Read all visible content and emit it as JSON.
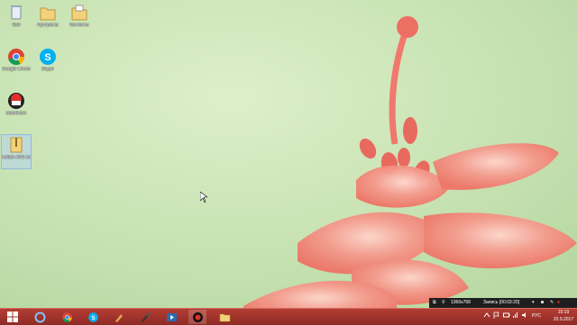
{
  "desktop": {
    "icons": [
      {
        "label": "Кой"
      },
      {
        "label": "Программ"
      },
      {
        "label": "Контакты"
      },
      {
        "label": "Google Chrome"
      },
      {
        "label": "Skype"
      },
      {
        "label": "Bandicam"
      },
      {
        "label": "Adobe AVS 3.0"
      }
    ]
  },
  "recording": {
    "resolution": "1366x768",
    "status_label": "Запись [00:03:20]"
  },
  "taskbar": {
    "language": "РУС",
    "time": "15:19",
    "date": "20.9.2017"
  },
  "colors": {
    "taskbar": "#9a2f29",
    "wallpaper": "#c9e3b4",
    "flower": "#f07e73"
  }
}
